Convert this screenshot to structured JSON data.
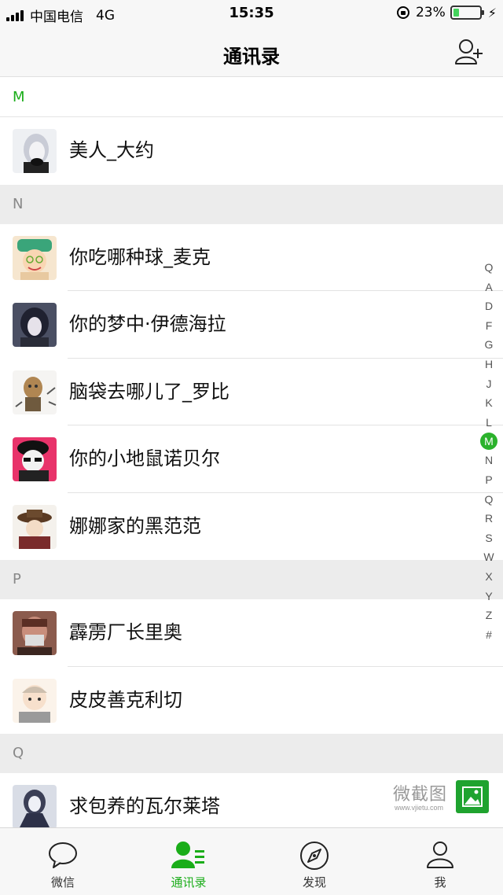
{
  "status_bar": {
    "carrier": "中国电信",
    "network": "4G",
    "time": "15:35",
    "battery": "23%",
    "battery_level": 0.23
  },
  "header": {
    "title": "通讯录"
  },
  "sections": [
    {
      "letter": "M",
      "active": true,
      "contacts": [
        {
          "name": "美人_大约"
        }
      ]
    },
    {
      "letter": "N",
      "contacts": [
        {
          "name": "你吃哪种球_麦克"
        },
        {
          "name": "你的梦中·伊德海拉"
        },
        {
          "name": "脑袋去哪儿了_罗比"
        },
        {
          "name": "你的小地鼠诺贝尔"
        },
        {
          "name": "娜娜家的黑范范"
        }
      ]
    },
    {
      "letter": "P",
      "contacts": [
        {
          "name": "霹雳厂长里奥"
        },
        {
          "name": "皮皮善克利切"
        }
      ]
    },
    {
      "letter": "Q",
      "contacts": [
        {
          "name": "求包养的瓦尔莱塔"
        }
      ]
    }
  ],
  "index_bar": [
    "Q",
    "A",
    "D",
    "F",
    "G",
    "H",
    "J",
    "K",
    "L",
    "M",
    "N",
    "P",
    "Q",
    "R",
    "S",
    "W",
    "X",
    "Y",
    "Z",
    "#"
  ],
  "index_active": "M",
  "watermark": {
    "text": "微截图",
    "url": "www.vjietu.com"
  },
  "tab_bar": [
    {
      "label": "微信",
      "icon": "chat-icon"
    },
    {
      "label": "通讯录",
      "icon": "contacts-icon",
      "active": true
    },
    {
      "label": "发现",
      "icon": "compass-icon"
    },
    {
      "label": "我",
      "icon": "person-icon"
    }
  ],
  "colors": {
    "accent": "#1aad19",
    "section_bg": "#ececec",
    "bar_bg": "#f7f7f7"
  }
}
